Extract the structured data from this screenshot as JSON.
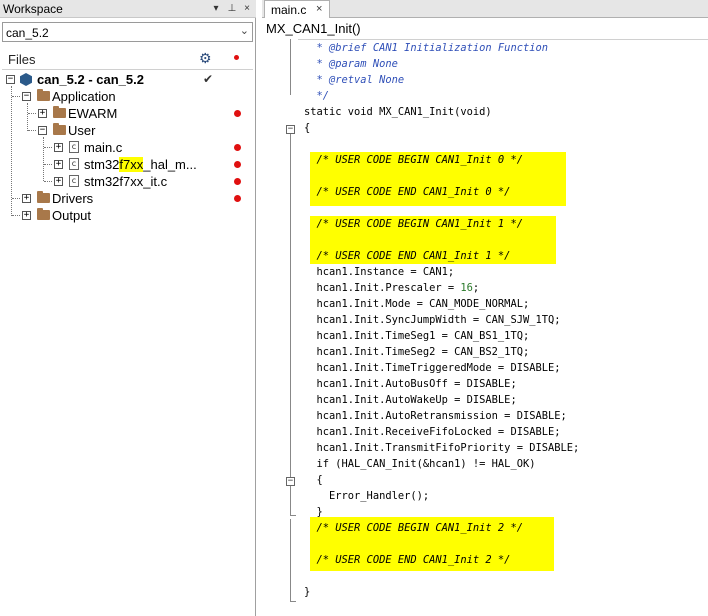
{
  "workspace": {
    "title": "Workspace",
    "header_buttons": [
      "▾",
      "⊥",
      "×"
    ],
    "project_select": {
      "value": "can_5.2"
    },
    "files_label": "Files",
    "tree": {
      "root": {
        "label": "can_5.2 - can_5.2"
      },
      "application": {
        "label": "Application"
      },
      "ewarm": {
        "label": "EWARM"
      },
      "user": {
        "label": "User"
      },
      "main_c": {
        "label": "main.c"
      },
      "hal_msp_pre": {
        "label": "stm32"
      },
      "hal_msp_hl": {
        "label": "f7xx"
      },
      "hal_msp_post": {
        "label": "_hal_m..."
      },
      "it_c": {
        "label": "stm32f7xx_it.c"
      },
      "drivers": {
        "label": "Drivers"
      },
      "output": {
        "label": "Output"
      }
    }
  },
  "editor": {
    "tab": {
      "label": "main.c",
      "close": "×"
    },
    "function_bar": "MX_CAN1_Init()",
    "code": [
      {
        "text": "  * @brief CAN1 Initialization Function",
        "cls": "c-comment"
      },
      {
        "text": "  * @param None",
        "cls": "c-comment"
      },
      {
        "text": "  * @retval None",
        "cls": "c-comment"
      },
      {
        "text": "  */",
        "cls": "c-comment"
      },
      {
        "text": "static void MX_CAN1_Init(void)",
        "cls": ""
      },
      {
        "text": "{",
        "cls": ""
      },
      {
        "text": "",
        "cls": ""
      },
      {
        "text": "  /* USER CODE BEGIN CAN1_Init 0 */",
        "cls": "c-usercmt"
      },
      {
        "text": "",
        "cls": ""
      },
      {
        "text": "  /* USER CODE END CAN1_Init 0 */",
        "cls": "c-usercmt"
      },
      {
        "text": "",
        "cls": ""
      },
      {
        "text": "  /* USER CODE BEGIN CAN1_Init 1 */",
        "cls": "c-usercmt"
      },
      {
        "text": "",
        "cls": ""
      },
      {
        "text": "  /* USER CODE END CAN1_Init 1 */",
        "cls": "c-usercmt"
      },
      {
        "text": "  hcan1.Instance = CAN1;",
        "cls": ""
      },
      {
        "text": "  hcan1.Init.Prescaler = ",
        "cls": "",
        "num": "16",
        "tail": ";"
      },
      {
        "text": "  hcan1.Init.Mode = CAN_MODE_NORMAL;",
        "cls": ""
      },
      {
        "text": "  hcan1.Init.SyncJumpWidth = CAN_SJW_1TQ;",
        "cls": ""
      },
      {
        "text": "  hcan1.Init.TimeSeg1 = CAN_BS1_1TQ;",
        "cls": ""
      },
      {
        "text": "  hcan1.Init.TimeSeg2 = CAN_BS2_1TQ;",
        "cls": ""
      },
      {
        "text": "  hcan1.Init.TimeTriggeredMode = DISABLE;",
        "cls": ""
      },
      {
        "text": "  hcan1.Init.AutoBusOff = DISABLE;",
        "cls": ""
      },
      {
        "text": "  hcan1.Init.AutoWakeUp = DISABLE;",
        "cls": ""
      },
      {
        "text": "  hcan1.Init.AutoRetransmission = DISABLE;",
        "cls": ""
      },
      {
        "text": "  hcan1.Init.ReceiveFifoLocked = DISABLE;",
        "cls": ""
      },
      {
        "text": "  hcan1.Init.TransmitFifoPriority = DISABLE;",
        "cls": ""
      },
      {
        "text": "  if (HAL_CAN_Init(&hcan1) != HAL_OK)",
        "cls": ""
      },
      {
        "text": "  {",
        "cls": ""
      },
      {
        "text": "    Error_Handler();",
        "cls": ""
      },
      {
        "text": "  }",
        "cls": ""
      },
      {
        "text": "  /* USER CODE BEGIN CAN1_Init 2 */",
        "cls": "c-usercmt"
      },
      {
        "text": "",
        "cls": ""
      },
      {
        "text": "  /* USER CODE END CAN1_Init 2 */",
        "cls": "c-usercmt"
      },
      {
        "text": "",
        "cls": ""
      },
      {
        "text": "}",
        "cls": ""
      }
    ]
  },
  "colors": {
    "highlight": "#ffff00",
    "comment": "#3050b8",
    "number": "#2a7a2a",
    "error_dot": "#e01010",
    "folder": "#a8784a"
  }
}
